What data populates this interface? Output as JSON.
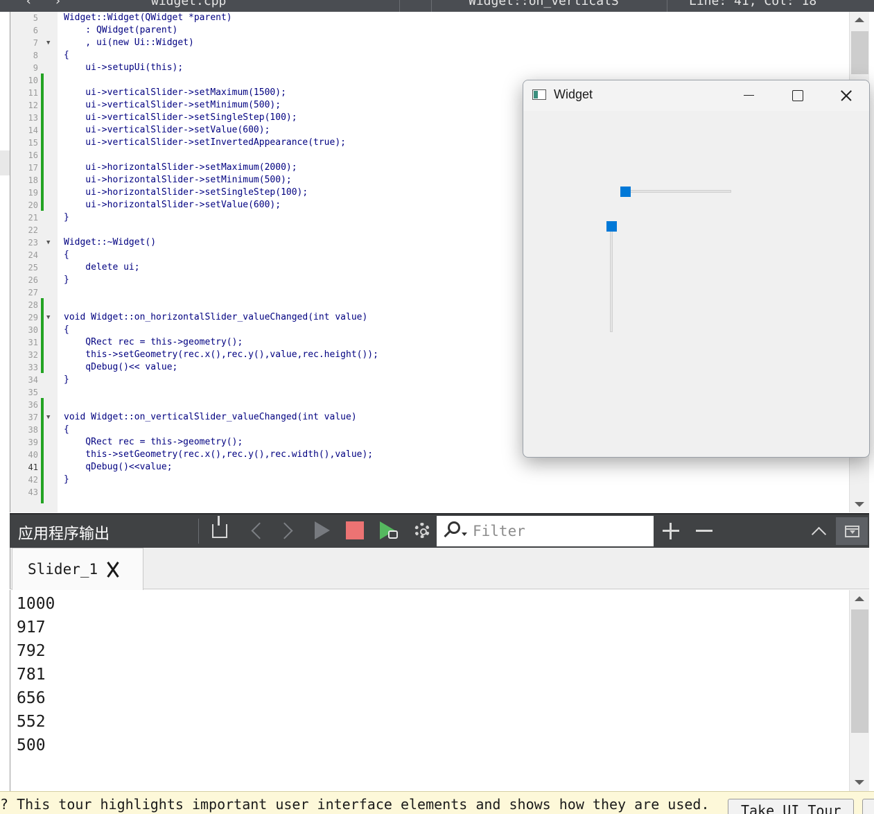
{
  "top_toolbar": {
    "file_name": "widget.cpp",
    "function_name": "Widget::on_verticalS",
    "cursor_position": "Line: 41, Col: 18"
  },
  "editor": {
    "lines": [
      {
        "n": "5",
        "code": "Widget::Widget(QWidget *parent)"
      },
      {
        "n": "6",
        "code": "    : QWidget(parent)"
      },
      {
        "n": "7",
        "code": "    , ui(new Ui::Widget)"
      },
      {
        "n": "8",
        "code": "{"
      },
      {
        "n": "9",
        "code": "    ui->setupUi(this);"
      },
      {
        "n": "10",
        "code": ""
      },
      {
        "n": "11",
        "code": "    ui->verticalSlider->setMaximum(1500);"
      },
      {
        "n": "12",
        "code": "    ui->verticalSlider->setMinimum(500);"
      },
      {
        "n": "13",
        "code": "    ui->verticalSlider->setSingleStep(100);"
      },
      {
        "n": "14",
        "code": "    ui->verticalSlider->setValue(600);"
      },
      {
        "n": "15",
        "code": "    ui->verticalSlider->setInvertedAppearance(true);"
      },
      {
        "n": "16",
        "code": ""
      },
      {
        "n": "17",
        "code": "    ui->horizontalSlider->setMaximum(2000);"
      },
      {
        "n": "18",
        "code": "    ui->horizontalSlider->setMinimum(500);"
      },
      {
        "n": "19",
        "code": "    ui->horizontalSlider->setSingleStep(100);"
      },
      {
        "n": "20",
        "code": "    ui->horizontalSlider->setValue(600);"
      },
      {
        "n": "21",
        "code": "}"
      },
      {
        "n": "22",
        "code": ""
      },
      {
        "n": "23",
        "code": "Widget::~Widget()"
      },
      {
        "n": "24",
        "code": "{"
      },
      {
        "n": "25",
        "code": "    delete ui;"
      },
      {
        "n": "26",
        "code": "}"
      },
      {
        "n": "27",
        "code": ""
      },
      {
        "n": "28",
        "code": ""
      },
      {
        "n": "29",
        "code": "void Widget::on_horizontalSlider_valueChanged(int value)"
      },
      {
        "n": "30",
        "code": "{"
      },
      {
        "n": "31",
        "code": "    QRect rec = this->geometry();"
      },
      {
        "n": "32",
        "code": "    this->setGeometry(rec.x(),rec.y(),value,rec.height());"
      },
      {
        "n": "33",
        "code": "    qDebug()<< value;"
      },
      {
        "n": "34",
        "code": "}"
      },
      {
        "n": "35",
        "code": ""
      },
      {
        "n": "36",
        "code": ""
      },
      {
        "n": "37",
        "code": "void Widget::on_verticalSlider_valueChanged(int value)"
      },
      {
        "n": "38",
        "code": "{"
      },
      {
        "n": "39",
        "code": "    QRect rec = this->geometry();"
      },
      {
        "n": "40",
        "code": "    this->setGeometry(rec.x(),rec.y(),rec.width(),value);"
      },
      {
        "n": "41",
        "code": "    qDebug()<<value;"
      },
      {
        "n": "42",
        "code": "}"
      },
      {
        "n": "43",
        "code": ""
      }
    ]
  },
  "widget_window": {
    "title": "Widget",
    "horizontal_slider_value": 600,
    "vertical_slider_value": 600
  },
  "output_toolbar": {
    "title": "应用程序输出",
    "filter_placeholder": "Filter"
  },
  "output_tab": {
    "label": "Slider_1"
  },
  "output_log": {
    "lines": [
      "1000",
      "917",
      "792",
      "781",
      "656",
      "552",
      "500"
    ]
  },
  "tour_bar": {
    "text": "? This tour highlights important user interface elements and shows how they are used.",
    "button_label": "Take UI Tour"
  },
  "colors": {
    "slider_handle": "#0078d7",
    "change_bar": "#23a323",
    "stop_button": "#ec7373",
    "run_debug": "#55b85f",
    "output_toolbar_bg": "#404244"
  },
  "icons": [
    "clear-output-icon",
    "previous-icon",
    "next-icon",
    "run-icon",
    "stop-icon",
    "rerun-icon",
    "settings-icon",
    "search-icon",
    "zoom-in-icon",
    "zoom-out-icon",
    "collapse-icon",
    "close-pane-icon",
    "close-tab-icon",
    "minimize-icon",
    "maximize-icon",
    "close-icon",
    "app-icon"
  ]
}
